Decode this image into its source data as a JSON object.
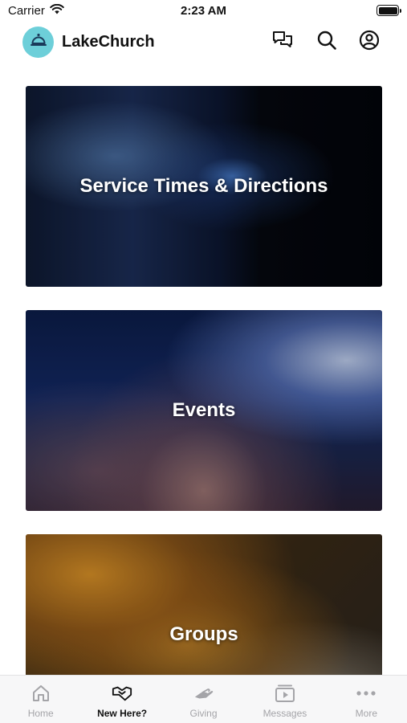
{
  "status_bar": {
    "carrier": "Carrier",
    "time": "2:23 AM"
  },
  "header": {
    "app_title": "LakeChurch",
    "logo_icon": "bell-cloche-icon",
    "logo_color": "#6dcfd9",
    "actions": [
      "chat-icon",
      "search-icon",
      "profile-icon"
    ]
  },
  "cards": [
    {
      "title": "Service Times & Directions",
      "image": "concert-stage-blue-lights"
    },
    {
      "title": "Events",
      "image": "crowd-worship-hands-raised"
    },
    {
      "title": "Groups",
      "image": "group-bible-study-warm"
    }
  ],
  "tab_bar": {
    "active_index": 1,
    "tabs": [
      {
        "label": "Home",
        "icon": "home-icon"
      },
      {
        "label": "New Here?",
        "icon": "handshake-icon"
      },
      {
        "label": "Giving",
        "icon": "giving-hand-icon"
      },
      {
        "label": "Messages",
        "icon": "video-play-icon"
      },
      {
        "label": "More",
        "icon": "more-dots-icon"
      }
    ]
  },
  "colors": {
    "active_tab": "#111111",
    "inactive_tab": "#a4a4a8",
    "tab_bar_bg": "#f7f7f8"
  }
}
